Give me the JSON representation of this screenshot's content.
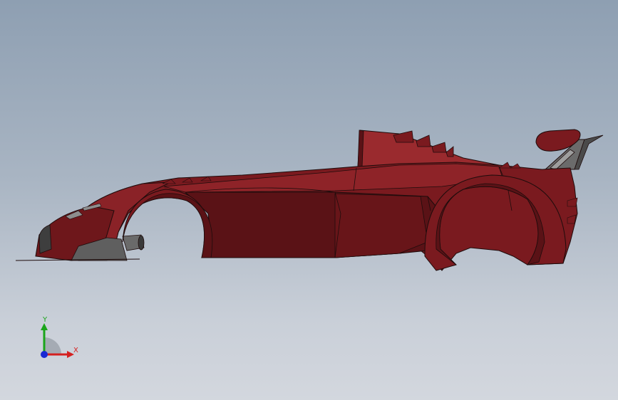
{
  "viewport": {
    "background_top": "#8e9fb2",
    "background_bottom": "#d3d7de"
  },
  "model": {
    "body_color": "#7a1a1f",
    "body_shadow_color": "#5a1216",
    "body_highlight_color": "#9a2a2e",
    "trim_color": "#555555",
    "edge_color": "#1e0c0c"
  },
  "triad": {
    "y_label": "Y",
    "x_label": "X",
    "y_color": "#1aa51a",
    "x_color": "#d42020",
    "z_color": "#1a2ad4",
    "icon": "coordinate-triad-icon"
  }
}
